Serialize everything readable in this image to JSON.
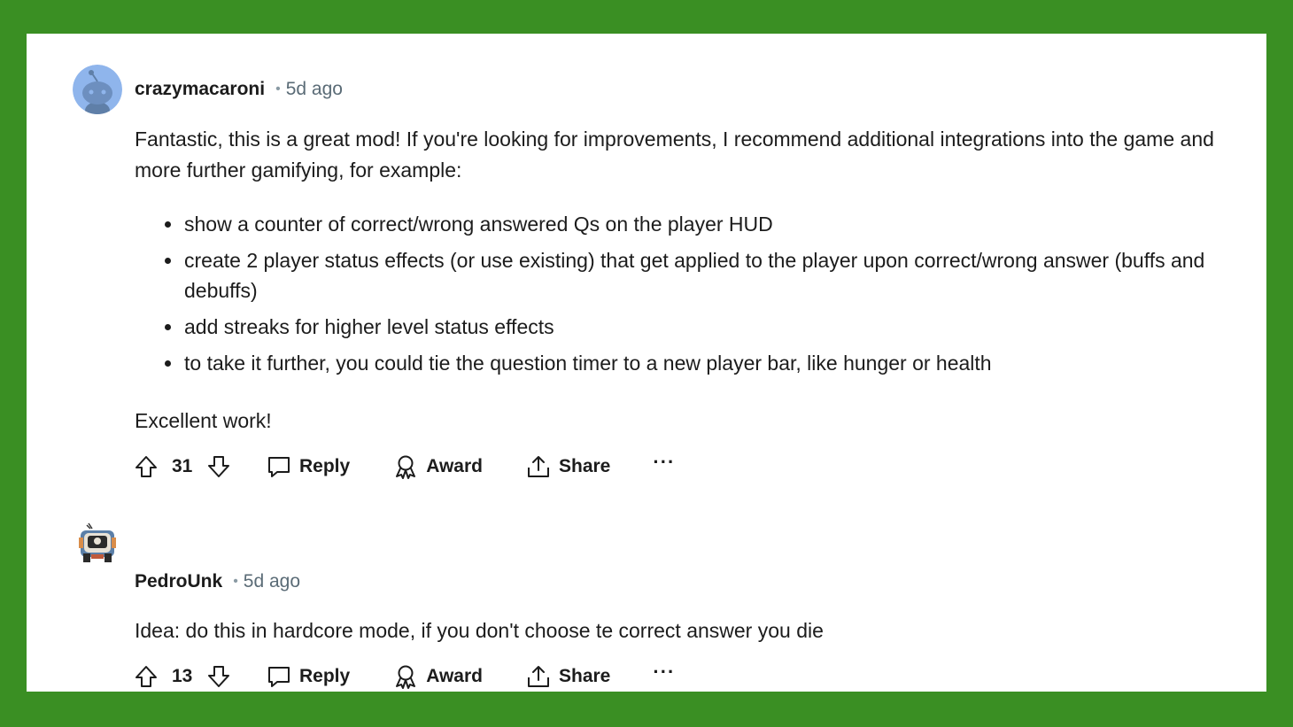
{
  "colors": {
    "frame": "#3a8f23",
    "panel": "#ffffff",
    "text": "#1c1c1c",
    "muted": "#5a6b76"
  },
  "comments": [
    {
      "username": "crazymacaroni",
      "time": "5d ago",
      "paragraph1": "Fantastic, this is a great mod! If you're looking for improvements, I recommend additional integrations into the game and more further gamifying, for example:",
      "bullets": [
        "show a counter of correct/wrong answered Qs on the player HUD",
        "create 2 player status effects (or use existing) that get applied to the player upon correct/wrong answer (buffs and debuffs)",
        "add streaks for higher level status effects",
        "to take it further, you could tie the question timer to a new player bar, like hunger or health"
      ],
      "paragraph2": "Excellent work!",
      "score": "31",
      "reply_label": "Reply",
      "award_label": "Award",
      "share_label": "Share",
      "more_label": "···"
    },
    {
      "username": "PedroUnk",
      "time": "5d ago",
      "paragraph1": "Idea: do this in hardcore mode, if you don't choose te correct answer you die",
      "score": "13",
      "reply_label": "Reply",
      "award_label": "Award",
      "share_label": "Share",
      "more_label": "···"
    }
  ]
}
